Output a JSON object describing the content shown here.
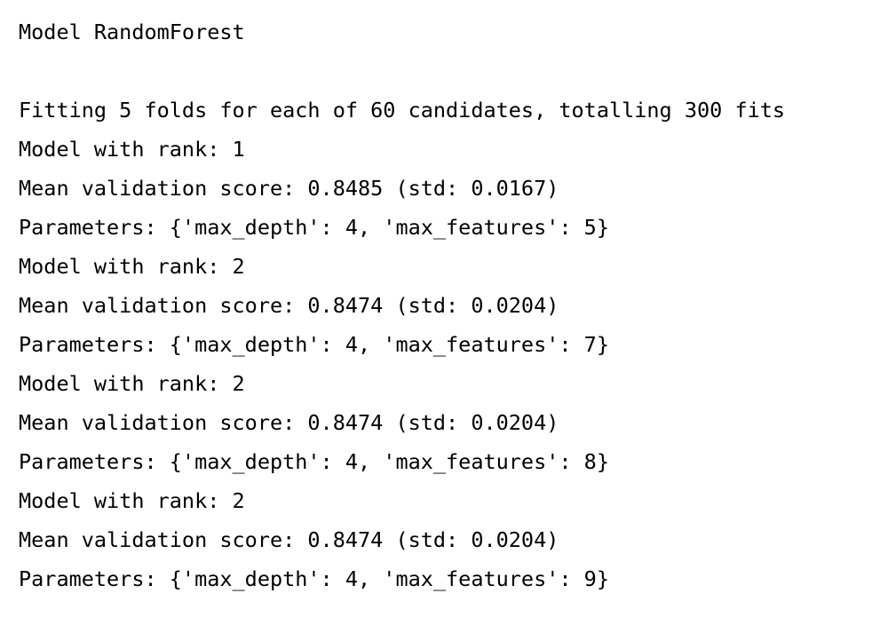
{
  "console": {
    "header": "Model RandomForest",
    "fitting": "Fitting 5 folds for each of 60 candidates, totalling 300 fits",
    "results": [
      {
        "rank_line": "Model with rank: 1",
        "score_line": "Mean validation score: 0.8485 (std: 0.0167)",
        "params_line": "Parameters: {'max_depth': 4, 'max_features': 5}"
      },
      {
        "rank_line": "Model with rank: 2",
        "score_line": "Mean validation score: 0.8474 (std: 0.0204)",
        "params_line": "Parameters: {'max_depth': 4, 'max_features': 7}"
      },
      {
        "rank_line": "Model with rank: 2",
        "score_line": "Mean validation score: 0.8474 (std: 0.0204)",
        "params_line": "Parameters: {'max_depth': 4, 'max_features': 8}"
      },
      {
        "rank_line": "Model with rank: 2",
        "score_line": "Mean validation score: 0.8474 (std: 0.0204)",
        "params_line": "Parameters: {'max_depth': 4, 'max_features': 9}"
      }
    ]
  }
}
